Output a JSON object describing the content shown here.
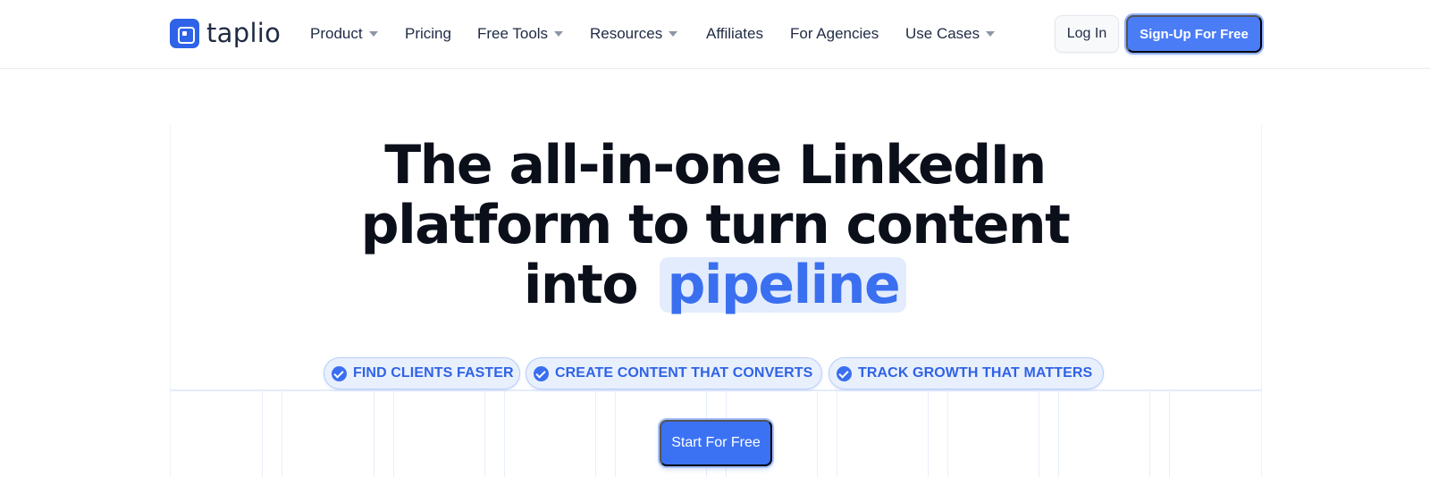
{
  "brand": {
    "name": "taplio",
    "accent": "#2e63e8"
  },
  "nav": {
    "items": [
      {
        "label": "Product",
        "has_dropdown": true
      },
      {
        "label": "Pricing",
        "has_dropdown": false
      },
      {
        "label": "Free Tools",
        "has_dropdown": true
      },
      {
        "label": "Resources",
        "has_dropdown": true
      },
      {
        "label": "Affiliates",
        "has_dropdown": false
      },
      {
        "label": "For Agencies",
        "has_dropdown": false
      },
      {
        "label": "Use Cases",
        "has_dropdown": true
      }
    ],
    "login_label": "Log In",
    "signup_label": "Sign-Up For Free"
  },
  "hero": {
    "headline_line1": "The all-in-one LinkedIn",
    "headline_line2": "platform to turn content",
    "headline_line3_prefix": "into",
    "headline_highlight": "pipeline",
    "highlight_color": "#3a6ff0",
    "features": [
      {
        "label": "FIND CLIENTS FASTER",
        "icon": "check-circle-icon"
      },
      {
        "label": "CREATE CONTENT THAT CONVERTS",
        "icon": "check-circle-icon"
      },
      {
        "label": "TRACK GROWTH THAT MATTERS",
        "icon": "check-circle-icon"
      }
    ],
    "cta_label": "Start For Free",
    "cta_color": "#3b72f4"
  }
}
